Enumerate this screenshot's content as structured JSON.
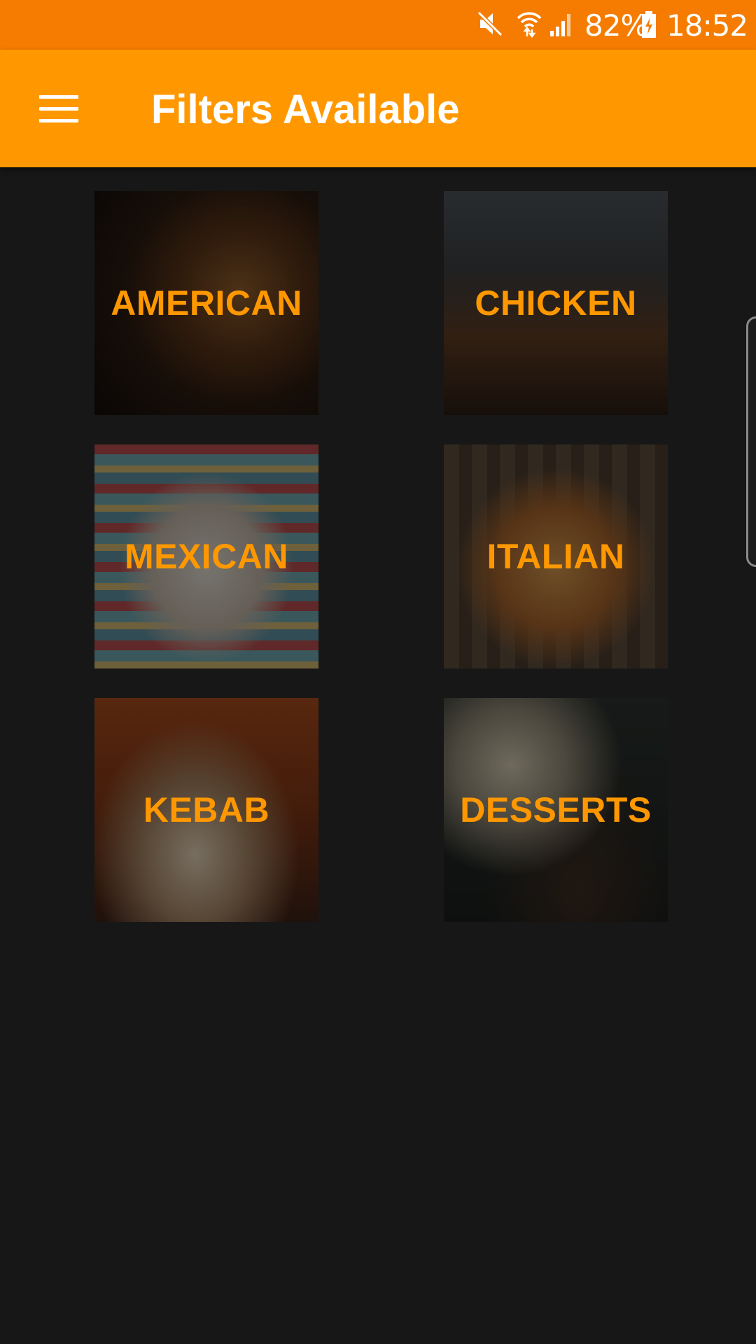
{
  "status_bar": {
    "battery_percent": "82%",
    "time": "18:52",
    "icons": [
      "mute-icon",
      "wifi-icon",
      "signal-icon",
      "battery-charging-icon"
    ]
  },
  "app_bar": {
    "title": "Filters Available",
    "menu_icon": "hamburger-menu-icon"
  },
  "categories": [
    {
      "label": "AMERICAN",
      "theme_color": "#3a2a1e"
    },
    {
      "label": "CHICKEN",
      "theme_color": "#2e2a26"
    },
    {
      "label": "MEXICAN",
      "theme_color": "#5c6e74"
    },
    {
      "label": "ITALIAN",
      "theme_color": "#4a3a2c"
    },
    {
      "label": "KEBAB",
      "theme_color": "#6a3a22"
    },
    {
      "label": "DESSERTS",
      "theme_color": "#1e2422"
    }
  ],
  "colors": {
    "status_bar": "#F57C00",
    "app_bar": "#FF9800",
    "background": "#171717",
    "accent_text": "#FF9800"
  }
}
